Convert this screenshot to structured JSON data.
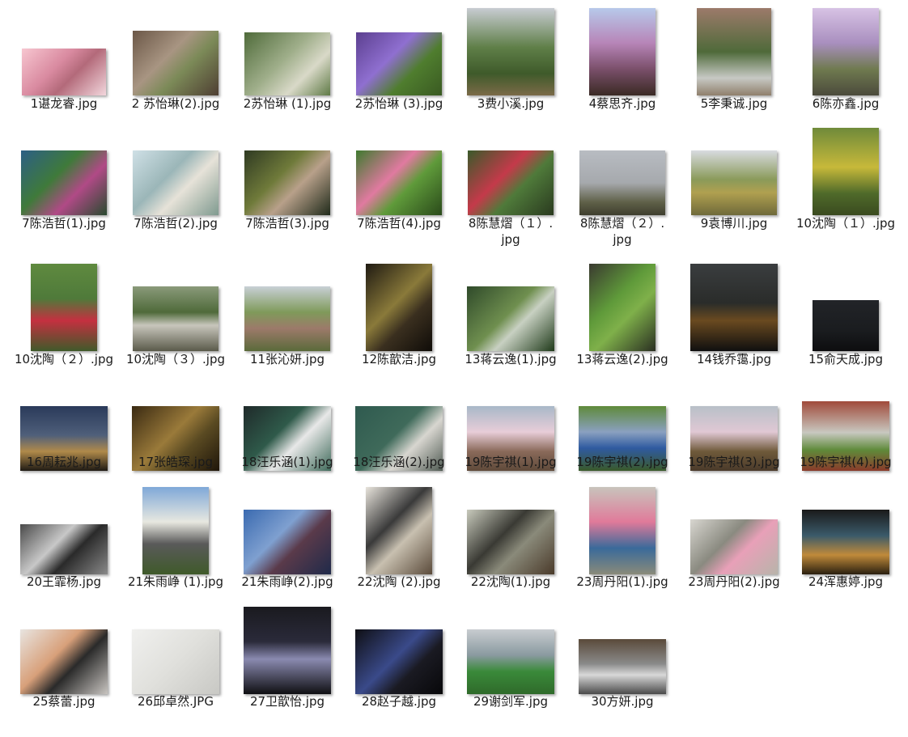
{
  "files": [
    {
      "name": "1谌龙睿.jpg",
      "fill": "linear-gradient(135deg,#f7c6d0,#d98aa0 40%,#b36a7a 60%,#f3d7dd)"
    },
    {
      "name": "2 苏怡琳(2).jpg",
      "fill": "linear-gradient(135deg,#6b5747,#a89582 40%,#7c8a58 60%,#4e3e32)"
    },
    {
      "name": "2苏怡琳 (1).jpg",
      "fill": "linear-gradient(135deg,#4f6b3a,#9fae8a 45%,#d9d9c8 70%,#5f7a46)"
    },
    {
      "name": "2苏怡琳 (3).jpg",
      "fill": "linear-gradient(135deg,#5b3f8f,#8f6fd0 40%,#4f7d2e 65%,#3a5a22)"
    },
    {
      "name": "3费小溪.jpg",
      "fill": "linear-gradient(180deg,#c8ccd2 0%,#5f7f48 45%,#3f5a2a 75%,#7b6a48)"
    },
    {
      "name": "4蔡思齐.jpg",
      "fill": "linear-gradient(180deg,#b7c9ea 0%,#b785b8 40%,#7a4f6a 70%,#3a2a24)"
    },
    {
      "name": "5李秉诚.jpg",
      "fill": "linear-gradient(180deg,#9c7a6a 0%,#4f6a3a 50%,#c7c9c4 80%,#8f7f6c)"
    },
    {
      "name": "6陈亦鑫.jpg",
      "fill": "linear-gradient(180deg,#d7c2e4 0%,#a98fbf 40%,#6f7a4f 70%,#4b4a3c)"
    },
    {
      "name": "7陈浩哲(1).jpg",
      "fill": "linear-gradient(135deg,#2c5f85,#3f7a3a 40%,#b04a86 65%,#294a2f)"
    },
    {
      "name": "7陈浩哲(2).jpg",
      "fill": "linear-gradient(135deg,#cfe0e6,#9bb6b8 40%,#e6e2d8 60%,#7f9a8f)"
    },
    {
      "name": "7陈浩哲(3).jpg",
      "fill": "linear-gradient(135deg,#2f3a22,#6f7a3a 40%,#b8a08a 60%,#1f2a1a)"
    },
    {
      "name": "7陈浩哲(4).jpg",
      "fill": "linear-gradient(135deg,#3f7a2f,#e07aa0 40%,#5f9a3a 60%,#2a4a1a)"
    },
    {
      "name": "8陈慧熠（１）.\njpg",
      "fill": "linear-gradient(135deg,#3a5a2a,#c43a4a 40%,#4f7a3a 60%,#2a3a1f)"
    },
    {
      "name": "8陈慧熠（２）.\njpg",
      "fill": "linear-gradient(180deg,#b8bcc2 0%,#a6a9ad 50%,#5f6048 80%,#3f3f2f)"
    },
    {
      "name": "9袁博川.jpg",
      "fill": "linear-gradient(180deg,#d8dbe0 0%,#8a9a5a 45%,#b0a050 65%,#6f6a3a)"
    },
    {
      "name": "10沈陶（１）.jpg",
      "fill": "linear-gradient(180deg,#6f8a3a 0%,#c7b93a 45%,#4f6a2a 75%,#3a4a1f)"
    },
    {
      "name": "10沈陶（２）.jpg",
      "fill": "linear-gradient(180deg,#5f8a3f 0%,#4f7a3a 40%,#c43040 65%,#3f5a2a)"
    },
    {
      "name": "10沈陶（３）.jpg",
      "fill": "linear-gradient(180deg,#8a9a7a 0%,#4f6a3a 40%,#c8c6bc 60%,#5a5a4a)"
    },
    {
      "name": "11张沁妍.jpg",
      "fill": "linear-gradient(180deg,#c8d0d6 0%,#7f9a5a 40%,#9c7a6a 65%,#5a6a3a)"
    },
    {
      "name": "12陈歆洁.jpg",
      "fill": "linear-gradient(135deg,#1f1a12,#8a7a3a 45%,#3a2f1f 65%,#0f0c08)"
    },
    {
      "name": "13蒋云逸(1).jpg",
      "fill": "linear-gradient(135deg,#2f4a2a,#6f8f4f 45%,#c8d0c2 60%,#1f3a1a)"
    },
    {
      "name": "13蒋云逸(2).jpg",
      "fill": "linear-gradient(135deg,#3a3a30,#5f9a3a 40%,#7fb04a 60%,#2a2f22)"
    },
    {
      "name": "14钱乔霭.jpg",
      "fill": "linear-gradient(180deg,#3a3d3f 0%,#2a2c2a 45%,#6a4a20 65%,#0f0f0f)"
    },
    {
      "name": "15俞天成.jpg",
      "fill": "linear-gradient(180deg,#222428 0%,#1a1c1f 60%,#0d0d0f)"
    },
    {
      "name": "16周耘兆.jpg",
      "fill": "linear-gradient(180deg,#2a3a5a 0%,#4f5f7a 45%,#b08a4a 70%,#1f1a14)"
    },
    {
      "name": "17张皓琛.jpg",
      "fill": "linear-gradient(135deg,#3a2a12,#9a7a3a 45%,#5a4a22 65%,#1f160a)"
    },
    {
      "name": "18汪乐涵(1).jpg",
      "fill": "linear-gradient(135deg,#1f2a2a,#2f5a4a 40%,#e8e8e8 60%,#3f6a5a)"
    },
    {
      "name": "18汪乐涵(2).jpg",
      "fill": "linear-gradient(135deg,#2f5a4f,#3f6a5a 45%,#d8d6d0 65%,#4f5a52)"
    },
    {
      "name": "19陈宇祺(1).jpg",
      "fill": "linear-gradient(180deg,#a8b8c8 0%,#e8cdd8 40%,#8a6a5a 70%,#5f4a3a)"
    },
    {
      "name": "19陈宇祺(2).jpg",
      "fill": "linear-gradient(180deg,#5f8a3a 0%,#8aa0c0 40%,#2f5aa0 65%,#3a5a2a)"
    },
    {
      "name": "19陈宇祺(3).jpg",
      "fill": "linear-gradient(180deg,#b8c0c8 0%,#e0c8d4 40%,#6f5a3a 70%,#4a3a2a)"
    },
    {
      "name": "19陈宇祺(4).jpg",
      "fill": "linear-gradient(180deg,#a04a3a 0%,#c8c8c0 45%,#5f8a3a 70%,#8a3a2a)"
    },
    {
      "name": "20王霏杨.jpg",
      "fill": "linear-gradient(135deg,#4a4a4a,#c8c8c8 40%,#2a2a2a 60%,#8a8a8a)"
    },
    {
      "name": "21朱雨峥 (1).jpg",
      "fill": "linear-gradient(180deg,#7fa8d8 0%,#e8e8e0 40%,#5a5a5a 65%,#3f5a2a)"
    },
    {
      "name": "21朱雨峥(2).jpg",
      "fill": "linear-gradient(135deg,#3a6ab0,#7fa0d0 40%,#5a3a4a 60%,#1f2a4a)"
    },
    {
      "name": "22沈陶 (2).jpg",
      "fill": "linear-gradient(135deg,#e8e4dc,#3a3a3a 40%,#c8c0b0 60%,#5a4a3a)"
    },
    {
      "name": "22沈陶(1).jpg",
      "fill": "linear-gradient(135deg,#c8cabc,#3a3a34 40%,#8a8a7a 60%,#4a3a2a)"
    },
    {
      "name": "23周丹阳(1).jpg",
      "fill": "linear-gradient(180deg,#c8c4bc 0%,#e07a9a 40%,#3a6a9a 70%,#8a8a7a)"
    },
    {
      "name": "23周丹阳(2).jpg",
      "fill": "linear-gradient(135deg,#d8d6d0,#8a8a80 40%,#e8a0b8 60%,#b8b4aa)"
    },
    {
      "name": "24浑惠婷.jpg",
      "fill": "linear-gradient(180deg,#1a1a1a 0%,#3a5a6a 40%,#c08a3a 70%,#2a2010)"
    },
    {
      "name": "25蔡蕾.jpg",
      "fill": "linear-gradient(135deg,#e8e4e0,#d8a07a 40%,#2a2a2a 60%,#c8c4c0)"
    },
    {
      "name": "26邱卓然.JPG",
      "fill": "linear-gradient(135deg,#f0f0ee,#e0e0dc 50%,#c8c8c4)"
    },
    {
      "name": "27卫歆怡.jpg",
      "fill": "linear-gradient(180deg,#1a1a1f 0%,#2a2a3a 40%,#8a8ab0 60%,#0f0f12)"
    },
    {
      "name": "28赵子越.jpg",
      "fill": "linear-gradient(135deg,#0f0f14,#3a4a8a 45%,#1a1a22 65%,#08080a)"
    },
    {
      "name": "29谢剑军.jpg",
      "fill": "linear-gradient(180deg,#c8ccd0 0%,#8a9aa0 40%,#3a8a3a 65%,#2f6a2a)"
    },
    {
      "name": "30方妍.jpg",
      "fill": "linear-gradient(180deg,#5a4a3a 0%,#8a8a8a 45%,#d8d8d8 65%,#4a4a4a)"
    }
  ]
}
